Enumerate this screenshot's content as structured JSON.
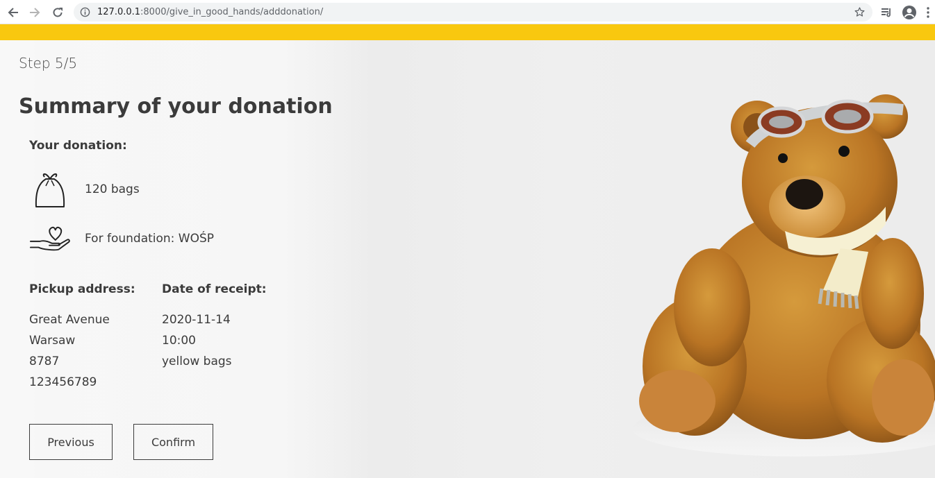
{
  "browser": {
    "url_host": "127.0.0.1",
    "url_rest": ":8000/give_in_good_hands/adddonation/"
  },
  "colors": {
    "accent": "#f9c80f",
    "text": "#3b3b3b"
  },
  "form": {
    "step": "Step 5/5",
    "title": "Summary of your donation",
    "your_donation_label": "Your donation:",
    "bags_text": "120 bags",
    "foundation_text": "For foundation: WOŚP",
    "pickup_label": "Pickup address:",
    "pickup_lines": [
      "Great Avenue",
      "Warsaw",
      "8787",
      "123456789"
    ],
    "date_label": "Date of receipt:",
    "date_lines": [
      "2020-11-14",
      "10:00",
      "yellow bags"
    ],
    "previous_button": "Previous",
    "confirm_button": "Confirm"
  },
  "icons": {
    "bag": "bag-icon",
    "hand_heart": "hand-heart-icon"
  }
}
